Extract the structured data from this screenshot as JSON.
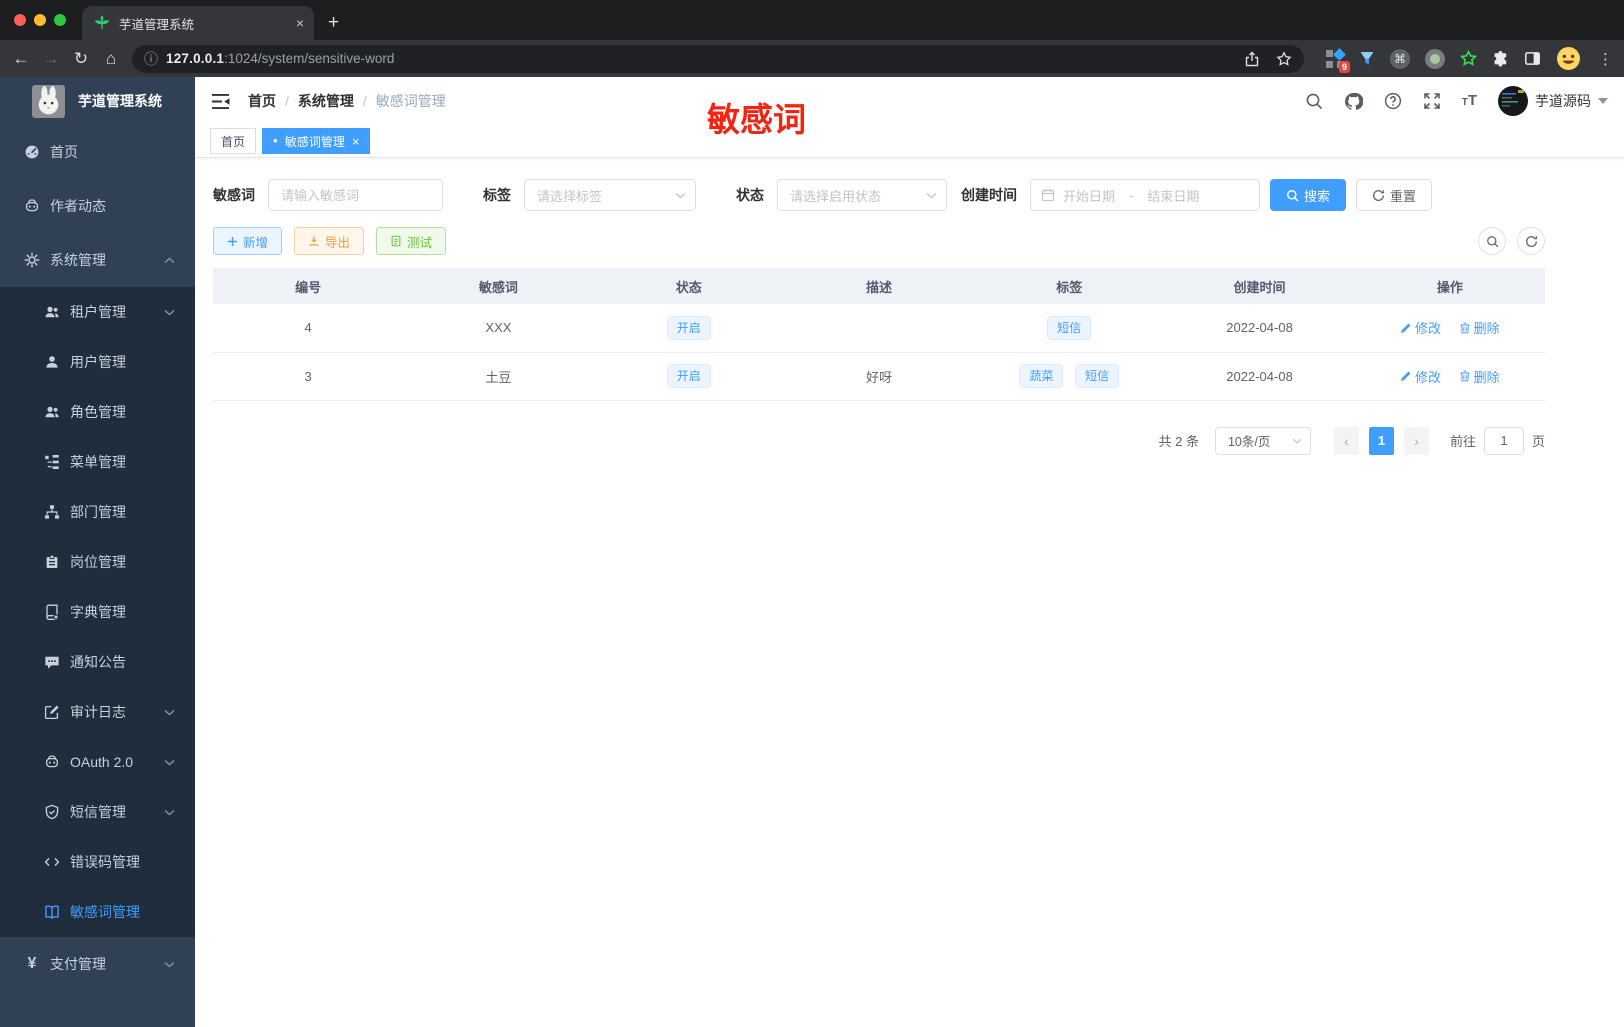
{
  "glyphs": {
    "back": "←",
    "forward": "→",
    "reload": "↻",
    "home": "⌂",
    "info": "ⓘ",
    "slash": "/",
    "dot": "●",
    "close": "×",
    "plus": "+",
    "dash": "-",
    "prev": "‹",
    "next": "›",
    "cmd": "⌘",
    "menu_dots": "⋮",
    "yen": "¥"
  },
  "browser": {
    "tab_title": "芋道管理系统",
    "url_host": "127.0.0.1",
    "url_rest": ":1024/system/sensitive-word",
    "extension_badge": "9"
  },
  "sidebar": {
    "app_title": "芋道管理系统",
    "items": [
      {
        "label": "首页"
      },
      {
        "label": "作者动态"
      },
      {
        "label": "系统管理"
      },
      {
        "label": "租户管理"
      },
      {
        "label": "用户管理"
      },
      {
        "label": "角色管理"
      },
      {
        "label": "菜单管理"
      },
      {
        "label": "部门管理"
      },
      {
        "label": "岗位管理"
      },
      {
        "label": "字典管理"
      },
      {
        "label": "通知公告"
      },
      {
        "label": "审计日志"
      },
      {
        "label": "OAuth 2.0"
      },
      {
        "label": "短信管理"
      },
      {
        "label": "错误码管理"
      },
      {
        "label": "敏感词管理"
      },
      {
        "label": "支付管理"
      }
    ]
  },
  "header": {
    "breadcrumb": [
      "首页",
      "系统管理",
      "敏感词管理"
    ],
    "username": "芋道源码",
    "annotation": "敏感词"
  },
  "tabs": [
    {
      "label": "首页"
    },
    {
      "label": "敏感词管理"
    }
  ],
  "filters": {
    "keyword_label": "敏感词",
    "keyword_placeholder": "请输入敏感词",
    "tag_label": "标签",
    "tag_placeholder": "请选择标签",
    "status_label": "状态",
    "status_placeholder": "请选择启用状态",
    "date_label": "创建时间",
    "date_start": "开始日期",
    "date_end": "结束日期",
    "search_label": "搜索",
    "reset_label": "重置"
  },
  "toolbar": {
    "add_label": "新增",
    "export_label": "导出",
    "test_label": "测试"
  },
  "table": {
    "headers": [
      "编号",
      "敏感词",
      "状态",
      "描述",
      "标签",
      "创建时间",
      "操作"
    ],
    "edit_label": "修改",
    "delete_label": "删除",
    "rows": [
      {
        "id": "4",
        "word": "XXX",
        "status": "开启",
        "desc": "",
        "tags": [
          "短信"
        ],
        "created": "2022-04-08"
      },
      {
        "id": "3",
        "word": "土豆",
        "status": "开启",
        "desc": "好呀",
        "tags": [
          "蔬菜",
          "短信"
        ],
        "created": "2022-04-08"
      }
    ]
  },
  "pagination": {
    "total": "共 2 条",
    "page_size": "10条/页",
    "page": "1",
    "goto_label": "前往",
    "goto_value": "1",
    "unit_label": "页"
  },
  "colors": {
    "accent": "#409eff",
    "sidebar_bg": "#304156",
    "submenu_bg": "#1f2d3d",
    "annotation_red": "#f22510",
    "tag_bg": "#ecf5ff",
    "warning": "#e6a23c",
    "success": "#67c23a"
  }
}
